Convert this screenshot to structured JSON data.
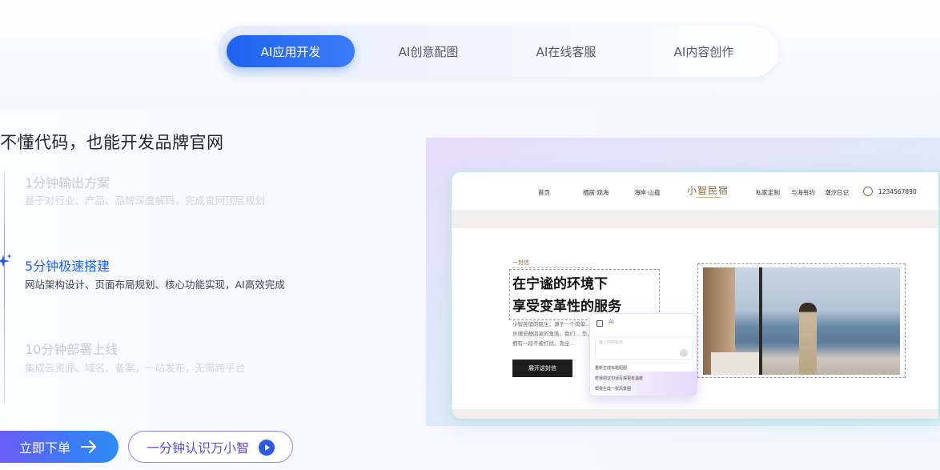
{
  "tabs": [
    {
      "label": "AI应用开发",
      "active": true
    },
    {
      "label": "AI创意配图",
      "active": false
    },
    {
      "label": "AI在线客服",
      "active": false
    },
    {
      "label": "AI内容创作",
      "active": false
    }
  ],
  "headline": "不懂代码，也能开发品牌官网",
  "steps": [
    {
      "title": "1分钟输出方案",
      "desc": "基于对行业、产品、品牌深度解码，完成官网顶层规划",
      "active": false
    },
    {
      "title": "5分钟极速搭建",
      "desc": "网站架构设计、页面布局规划、核心功能实现，AI高效完成",
      "active": true
    },
    {
      "title": "10分钟部署上线",
      "desc": "集成云资源、域名、备案，一站发布，无需跨平台",
      "active": false
    }
  ],
  "buttons": {
    "order": "立即下单",
    "learn": "一分钟认识万小智"
  },
  "preview": {
    "nav": {
      "home": "首页",
      "item1": "栖居·观海",
      "item2": "海岸·山蕴",
      "brand": "小智民宿",
      "item3": "私家定制",
      "item4": "与海有约",
      "item5": "潮汐日记",
      "phone": "1234567890"
    },
    "hero": {
      "kicker": "一封信",
      "title_line1": "在宁谧的环境下",
      "title_line2": "享受变革性的服务",
      "text": "小智民宿的诞生，源于一个简单… 让灵魂安静回家的角落。我们… 华，是拥有一段不被打扰、完全…",
      "button": "展开这封信"
    },
    "ai_popup": {
      "badge": "AI",
      "placeholder": "输入你的需求",
      "option1": "重新生成标题配图",
      "option2": "帮我把这句话写得更有温度",
      "option3": "帮我生成一张风景图"
    }
  },
  "colors": {
    "accent": "#1e63f0",
    "purple": "#6b5cf6",
    "brand_gold": "#8a6a3a"
  },
  "icons": {
    "arrow": "arrow-right-icon",
    "play": "play-circle-icon",
    "sparkle": "sparkle-icon",
    "phone": "phone-icon"
  }
}
